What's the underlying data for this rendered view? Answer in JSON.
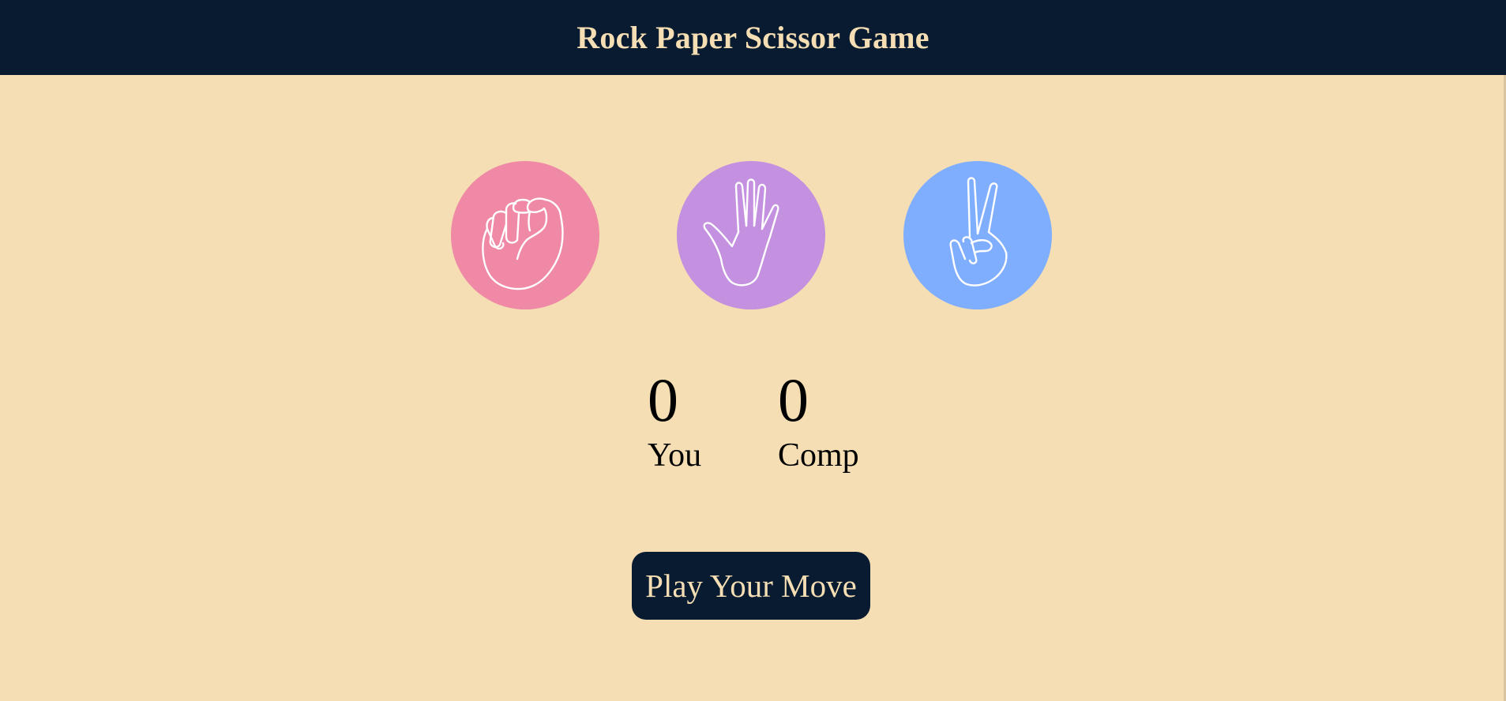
{
  "header": {
    "title": "Rock Paper Scissor Game",
    "background": "#081b31",
    "text_color": "#f5deb3"
  },
  "page": {
    "background": "#f5deb3"
  },
  "choices": [
    {
      "id": "rock",
      "icon": "fist-icon",
      "color": "#ef89a6"
    },
    {
      "id": "paper",
      "icon": "open-hand-icon",
      "color": "#c490e0"
    },
    {
      "id": "scissors",
      "icon": "peace-sign-icon",
      "color": "#80aeff"
    }
  ],
  "scoreboard": {
    "user": {
      "score": "0",
      "label": "You"
    },
    "comp": {
      "score": "0",
      "label": "Comp"
    }
  },
  "play_button": {
    "label": "Play Your Move"
  }
}
